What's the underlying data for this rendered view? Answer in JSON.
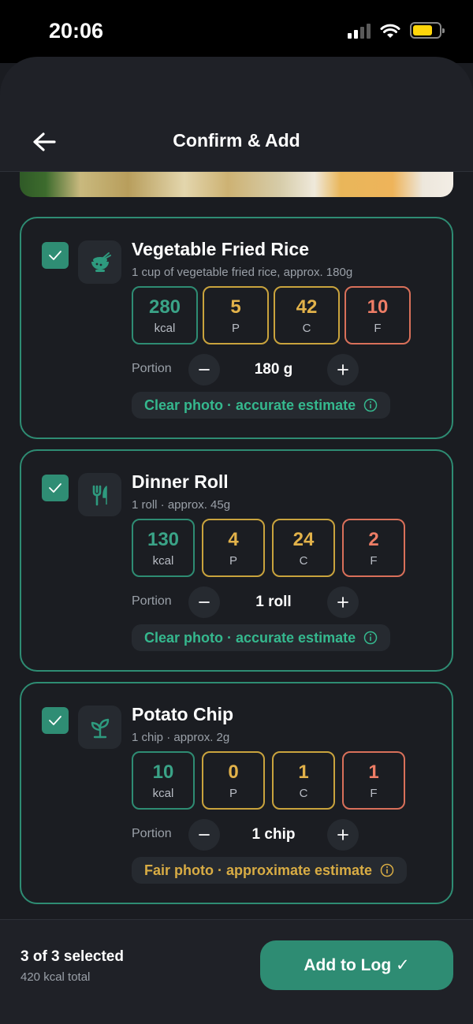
{
  "status_bar": {
    "time": "20:06"
  },
  "header": {
    "title": "Confirm & Add"
  },
  "portion_label": "Portion",
  "items": [
    {
      "name": "Vegetable Fried Rice",
      "description": "1 cup of vegetable fried rice, approx. 180g",
      "icon": "rice-bowl-icon",
      "checked": true,
      "macros": [
        {
          "value": "280",
          "label": "kcal"
        },
        {
          "value": "5",
          "label": "P"
        },
        {
          "value": "42",
          "label": "C"
        },
        {
          "value": "10",
          "label": "F"
        }
      ],
      "portion": "180 g",
      "estimate": "Clear photo · accurate estimate",
      "estimate_quality": "good"
    },
    {
      "name": "Dinner Roll",
      "description": "1 roll · approx. 45g",
      "icon": "fork-knife-icon",
      "checked": true,
      "macros": [
        {
          "value": "130",
          "label": "kcal"
        },
        {
          "value": "4",
          "label": "P"
        },
        {
          "value": "24",
          "label": "C"
        },
        {
          "value": "2",
          "label": "F"
        }
      ],
      "portion": "1 roll",
      "estimate": "Clear photo · accurate estimate",
      "estimate_quality": "good"
    },
    {
      "name": "Potato Chip",
      "description": "1 chip · approx. 2g",
      "icon": "sprout-icon",
      "checked": true,
      "macros": [
        {
          "value": "10",
          "label": "kcal"
        },
        {
          "value": "0",
          "label": "P"
        },
        {
          "value": "1",
          "label": "C"
        },
        {
          "value": "1",
          "label": "F"
        }
      ],
      "portion": "1 chip",
      "estimate": "Fair photo · approximate estimate",
      "estimate_quality": "fair"
    }
  ],
  "footer": {
    "selected": "3 of 3 selected",
    "total": "420 kcal total",
    "add_button": "Add to Log ✓"
  },
  "colors": {
    "accent": "#2e8c73",
    "protein": "#e2b24a",
    "carbs": "#e2b24a",
    "fat": "#ee7d66",
    "background": "#1a1c21"
  }
}
